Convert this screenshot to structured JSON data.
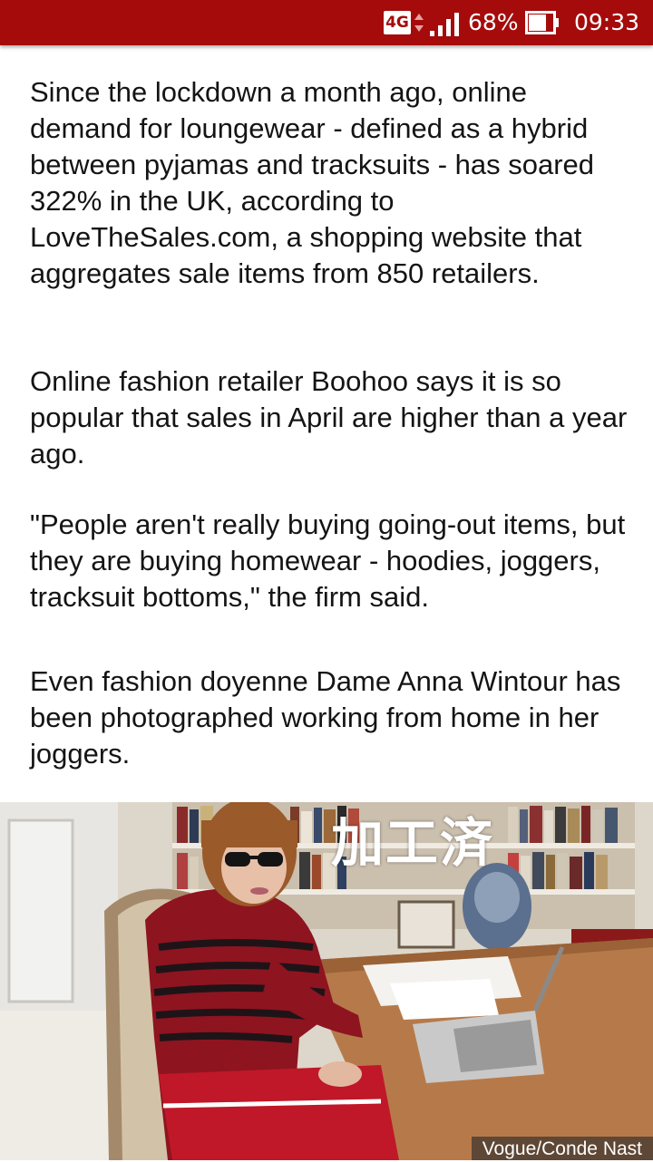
{
  "status_bar": {
    "network": "4G",
    "battery_percent": "68%",
    "time": "09:33"
  },
  "article": {
    "paragraphs": [
      "Since the lockdown a month ago, online demand for loungewear - defined as a hybrid between pyjamas and tracksuits - has soared 322% in the UK, according to LoveTheSales.com, a shopping website that aggregates sale items from 850 retailers.",
      "Online fashion retailer Boohoo says it is so popular that sales in April are higher than a year ago.",
      "\"People aren't really buying going-out items, but they are buying homewear - hoodies, joggers, tracksuit bottoms,\" the firm said.",
      "Even fashion doyenne Dame Anna Wintour has been photographed working from home in her joggers."
    ]
  },
  "image": {
    "watermark": "加工済",
    "credit": "Vogue/Conde Nast"
  },
  "colors": {
    "status_bar": "#a50b0b",
    "text": "#141414"
  }
}
